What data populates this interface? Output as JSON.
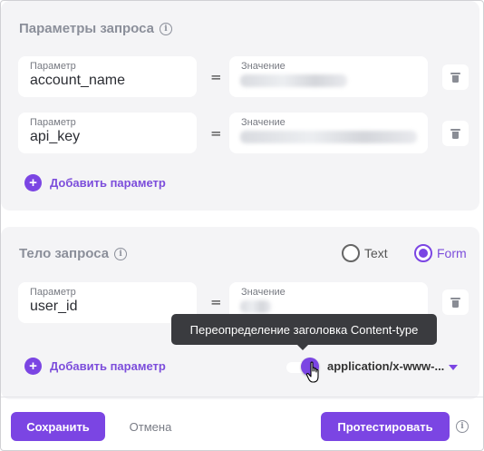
{
  "query_params": {
    "title": "Параметры запроса",
    "rows": [
      {
        "param_label": "Параметр",
        "param_value": "account_name",
        "eq": "=",
        "value_label": "Значение"
      },
      {
        "param_label": "Параметр",
        "param_value": "api_key",
        "eq": "=",
        "value_label": "Значение"
      }
    ],
    "add_label": "Добавить параметр"
  },
  "body_params": {
    "title": "Тело запроса",
    "radio_text": "Text",
    "radio_form": "Form",
    "selected": "Form",
    "rows": [
      {
        "param_label": "Параметр",
        "param_value": "user_id",
        "eq": "=",
        "value_label": "Значение"
      }
    ],
    "add_label": "Добавить параметр",
    "override_tooltip": "Переопределение заголовка Content-type",
    "override_enabled": true,
    "content_type": "application/x-www-..."
  },
  "footer": {
    "save_label": "Сохранить",
    "cancel_label": "Отмена",
    "test_label": "Протестировать"
  },
  "icons": {
    "info": "info-icon",
    "delete": "trash-icon",
    "add": "plus-icon",
    "dropdown": "chevron-down-icon"
  },
  "colors": {
    "accent": "#7b45e3",
    "card_bg": "#f4f4f6",
    "tooltip_bg": "#3a3b3f"
  }
}
